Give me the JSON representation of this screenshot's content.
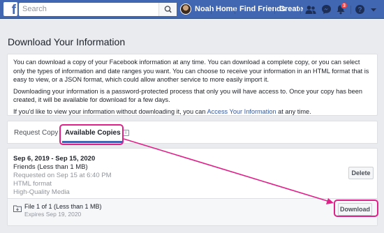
{
  "topbar": {
    "logo": "f",
    "search_placeholder": "Search",
    "profile_name": "Noah",
    "nav": [
      "Home",
      "Find Friends",
      "Create"
    ],
    "notification_count": "3",
    "icons": [
      "search-icon",
      "friend-requests-icon",
      "messenger-icon",
      "notifications-icon",
      "help-icon",
      "dropdown-arrow-icon"
    ]
  },
  "page": {
    "title": "Download Your Information",
    "info": {
      "p1": "You can download a copy of your Facebook information at any time. You can download a complete copy, or you can select only the types of information and date ranges you want. You can choose to receive your information in an HTML format that is easy to view, or a JSON format, which could allow another service to more easily import it.",
      "p2": "Downloading your information is a password-protected process that only you will have access to. Once your copy has been created, it will be available for download for a few days.",
      "p3_before": "If you'd like to view your information without downloading it, you can ",
      "p3_link": "Access Your Information",
      "p3_after": " at any time."
    },
    "tabs": {
      "request": "Request Copy",
      "available": "Available Copies",
      "info_glyph": "i"
    },
    "copy": {
      "date_range": "Sep 6, 2019 - Sep 15, 2020",
      "size": "Friends (Less than 1 MB)",
      "requested": "Requested on Sep 15 at 6:40 PM",
      "format": "HTML format",
      "quality": "High-Quality Media",
      "delete_label": "Delete",
      "file_label": "File 1 of 1 (Less than 1 MB)",
      "expires": "Expires Sep 19, 2020",
      "download_label": "Download"
    }
  },
  "colors": {
    "brand": "#4267b2",
    "annotation": "#e0218a"
  }
}
